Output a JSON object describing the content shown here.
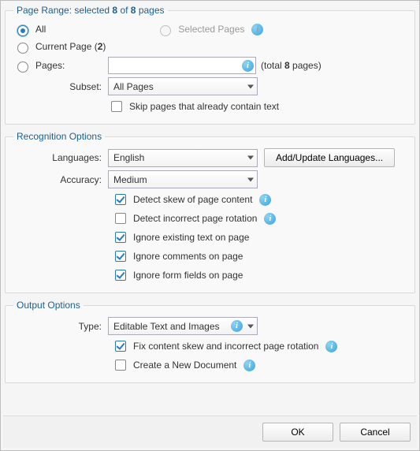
{
  "pageRange": {
    "legend_prefix": "Page Range: selected ",
    "legend_sel": "8",
    "legend_mid": " of ",
    "legend_total": "8",
    "legend_suffix": " pages",
    "all": "All",
    "selectedPages": "Selected Pages",
    "currentPage_prefix": "Current Page (",
    "currentPage_num": "2",
    "currentPage_suffix": ")",
    "pages": "Pages:",
    "total_prefix": " (total ",
    "total_num": "8",
    "total_suffix": " pages)",
    "subset_label": "Subset:",
    "subset_value": "All Pages",
    "skip": "Skip pages that already contain text"
  },
  "recognition": {
    "legend": "Recognition Options",
    "languages_label": "Languages:",
    "languages_value": "English",
    "add_update": "Add/Update Languages...",
    "accuracy_label": "Accuracy:",
    "accuracy_value": "Medium",
    "detect_skew": "Detect skew of page content",
    "detect_rotation": "Detect incorrect page rotation",
    "ignore_text": "Ignore existing text on page",
    "ignore_comments": "Ignore comments on page",
    "ignore_fields": "Ignore form fields on page"
  },
  "output": {
    "legend": "Output Options",
    "type_label": "Type:",
    "type_value": "Editable Text and Images",
    "fix_skew": "Fix content skew and incorrect page rotation",
    "new_doc": "Create a New Document"
  },
  "buttons": {
    "ok": "OK",
    "cancel": "Cancel"
  }
}
